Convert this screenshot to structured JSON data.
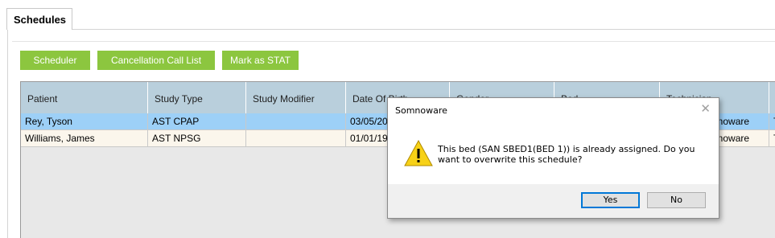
{
  "tabs": {
    "active": "Schedules"
  },
  "toolbar": {
    "scheduler": "Scheduler",
    "cancellation": "Cancellation Call List",
    "mark_stat": "Mark as STAT"
  },
  "grid": {
    "columns": [
      "Patient",
      "Study Type",
      "Study Modifier",
      "Date Of Birth",
      "Gender",
      "Bed",
      "Technician",
      ""
    ],
    "rows": [
      [
        "Rey, Tyson",
        "AST CPAP",
        "",
        "03/05/20",
        "",
        "",
        "nnoware",
        "T"
      ],
      [
        "Williams, James",
        "AST NPSG",
        "",
        "01/01/19",
        "",
        "",
        "nnoware",
        "T"
      ]
    ]
  },
  "dialog": {
    "title": "Somnoware",
    "close_icon": "close-icon",
    "message": "This bed (SAN SBED1(BED 1)) is already assigned. Do you want to overwrite this schedule?",
    "icon": "warning-icon",
    "yes": "Yes",
    "no": "No"
  },
  "colors": {
    "accent_green": "#8cc63f",
    "header_blue": "#b9cfdc",
    "selected_row": "#9dd0f7",
    "focus_blue": "#0078d7"
  }
}
